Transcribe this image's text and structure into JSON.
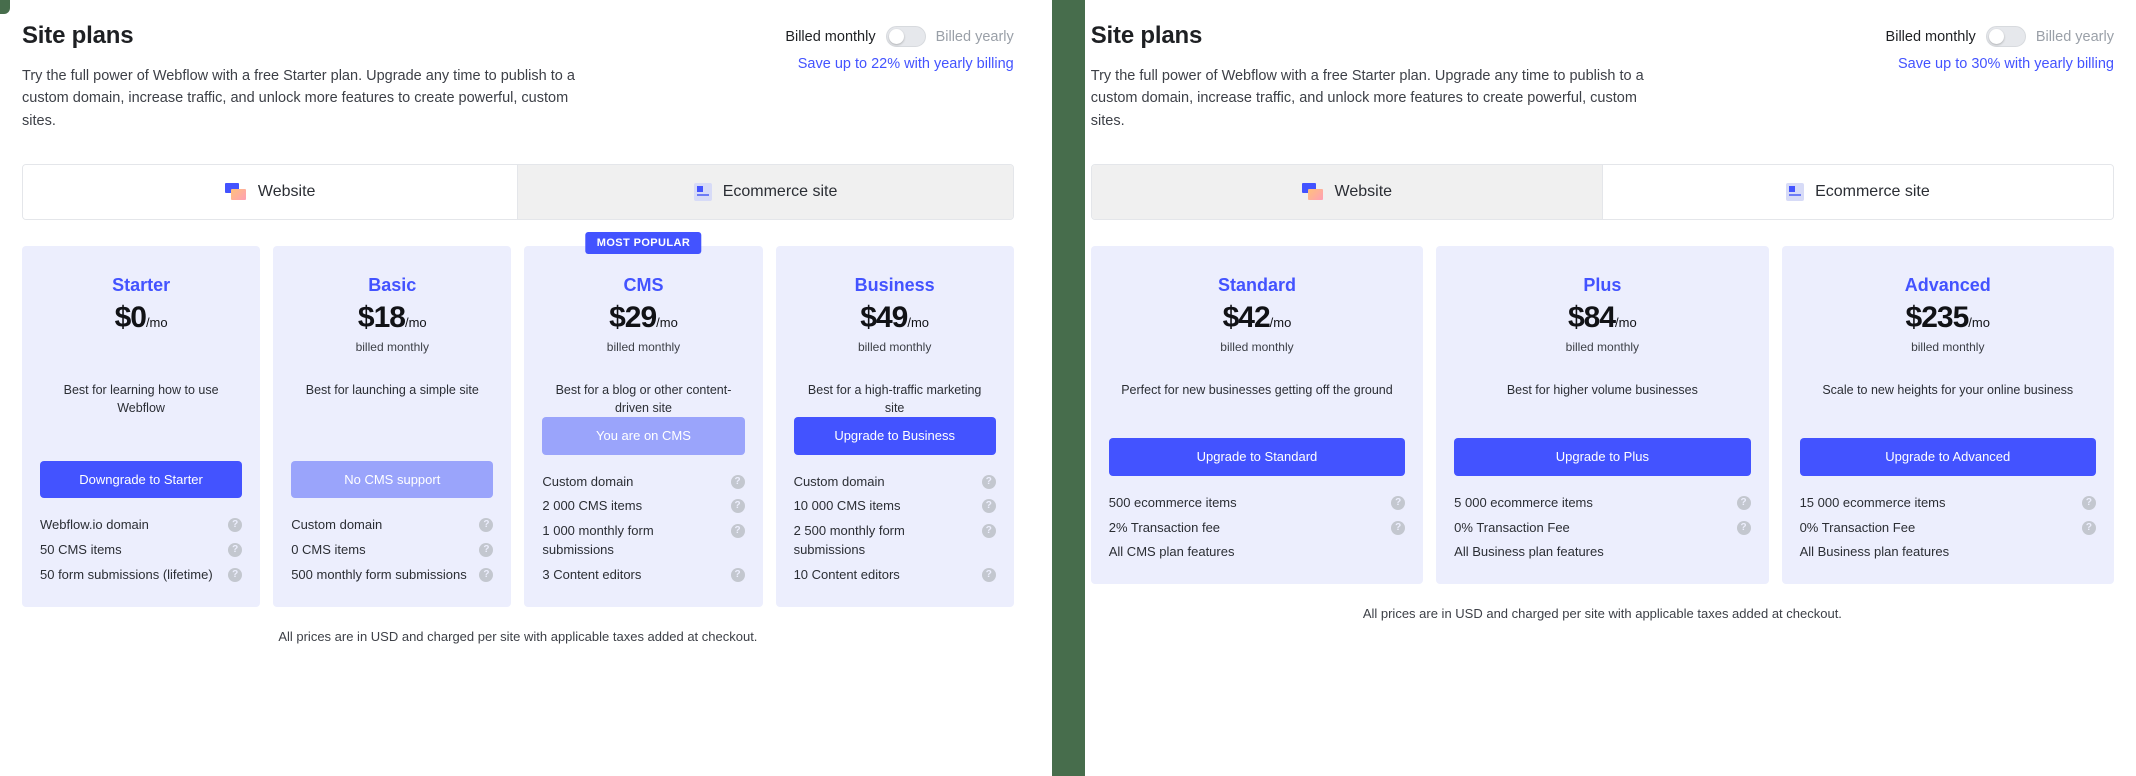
{
  "divider_color": "#476d4c",
  "accent_color": "#4353ff",
  "card_bg": "#eceefd",
  "panels": [
    {
      "id": "left",
      "header": {
        "title": "Site plans",
        "subtitle": "Try the full power of Webflow with a free Starter plan. Upgrade any time to publish to a custom domain, increase traffic, and unlock more features to create powerful, custom sites.",
        "billing": {
          "monthly_label": "Billed monthly",
          "yearly_label": "Billed yearly",
          "toggle_state": "monthly",
          "save_link": "Save up to 22% with yearly billing"
        }
      },
      "tabs": [
        {
          "label": "Website",
          "icon": "website-icon",
          "active": true
        },
        {
          "label": "Ecommerce site",
          "icon": "ecommerce-icon",
          "active": false
        }
      ],
      "plans": [
        {
          "name": "Starter",
          "price": "$0",
          "per": "/mo",
          "billed_note": "",
          "blurb": "Best for learning how to use Webflow",
          "cta_label": "Downgrade to Starter",
          "cta_disabled": false,
          "badge": "",
          "features": [
            {
              "text": "Webflow.io domain",
              "help": true
            },
            {
              "text": "50 CMS items",
              "help": true
            },
            {
              "text": "50 form submissions (lifetime)",
              "help": true
            }
          ]
        },
        {
          "name": "Basic",
          "price": "$18",
          "per": "/mo",
          "billed_note": "billed monthly",
          "blurb": "Best for launching a simple site",
          "cta_label": "No CMS support",
          "cta_disabled": true,
          "badge": "",
          "features": [
            {
              "text": "Custom domain",
              "help": true
            },
            {
              "text": "0 CMS items",
              "help": true
            },
            {
              "text": "500 monthly form submissions",
              "help": true
            }
          ]
        },
        {
          "name": "CMS",
          "price": "$29",
          "per": "/mo",
          "billed_note": "billed monthly",
          "blurb": "Best for a blog or other content-driven site",
          "cta_label": "You are on CMS",
          "cta_disabled": true,
          "badge": "MOST POPULAR",
          "features": [
            {
              "text": "Custom domain",
              "help": true
            },
            {
              "text": "2 000 CMS items",
              "help": true
            },
            {
              "text": "1 000 monthly form submissions",
              "help": true
            },
            {
              "text": "3 Content editors",
              "help": true
            }
          ]
        },
        {
          "name": "Business",
          "price": "$49",
          "per": "/mo",
          "billed_note": "billed monthly",
          "blurb": "Best for a high-traffic marketing site",
          "cta_label": "Upgrade to Business",
          "cta_disabled": false,
          "badge": "",
          "features": [
            {
              "text": "Custom domain",
              "help": true
            },
            {
              "text": "10 000 CMS items",
              "help": true
            },
            {
              "text": "2 500 monthly form submissions",
              "help": true
            },
            {
              "text": "10 Content editors",
              "help": true
            }
          ]
        }
      ],
      "footer_note": "All prices are in USD and charged per site with applicable taxes added at checkout."
    },
    {
      "id": "right",
      "header": {
        "title": "Site plans",
        "subtitle": "Try the full power of Webflow with a free Starter plan. Upgrade any time to publish to a custom domain, increase traffic, and unlock more features to create powerful, custom sites.",
        "billing": {
          "monthly_label": "Billed monthly",
          "yearly_label": "Billed yearly",
          "toggle_state": "monthly",
          "save_link": "Save up to 30% with yearly billing"
        }
      },
      "tabs": [
        {
          "label": "Website",
          "icon": "website-icon",
          "active": false
        },
        {
          "label": "Ecommerce site",
          "icon": "ecommerce-icon",
          "active": true
        }
      ],
      "plans": [
        {
          "name": "Standard",
          "price": "$42",
          "per": "/mo",
          "billed_note": "billed monthly",
          "blurb": "Perfect for new businesses getting off the ground",
          "cta_label": "Upgrade to Standard",
          "cta_disabled": false,
          "badge": "",
          "features": [
            {
              "text": "500 ecommerce items",
              "help": true
            },
            {
              "text": "2% Transaction fee",
              "help": true
            },
            {
              "text": "All CMS plan features",
              "help": false
            }
          ]
        },
        {
          "name": "Plus",
          "price": "$84",
          "per": "/mo",
          "billed_note": "billed monthly",
          "blurb": "Best for higher volume businesses",
          "cta_label": "Upgrade to Plus",
          "cta_disabled": false,
          "badge": "",
          "features": [
            {
              "text": "5 000 ecommerce items",
              "help": true
            },
            {
              "text": "0% Transaction Fee",
              "help": true
            },
            {
              "text": "All Business plan features",
              "help": false
            }
          ]
        },
        {
          "name": "Advanced",
          "price": "$235",
          "per": "/mo",
          "billed_note": "billed monthly",
          "blurb": "Scale to new heights for your online business",
          "cta_label": "Upgrade to Advanced",
          "cta_disabled": false,
          "badge": "",
          "features": [
            {
              "text": "15 000 ecommerce items",
              "help": true
            },
            {
              "text": "0% Transaction Fee",
              "help": true
            },
            {
              "text": "All Business plan features",
              "help": false
            }
          ]
        }
      ],
      "footer_note": "All prices are in USD and charged per site with applicable taxes added at checkout."
    }
  ],
  "help_glyph": "?"
}
